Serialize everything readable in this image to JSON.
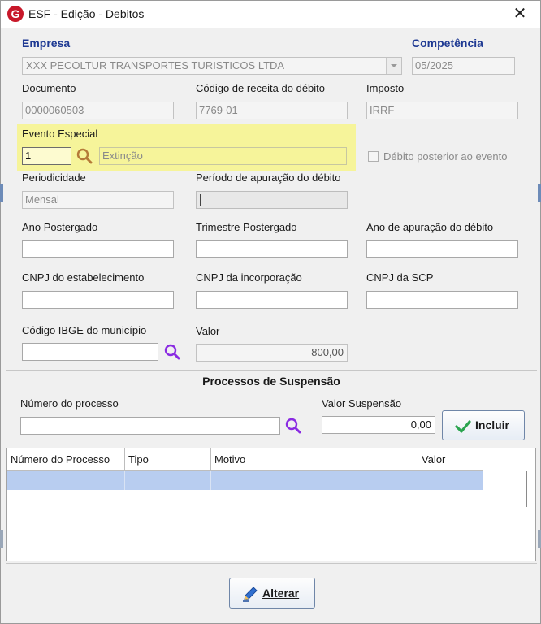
{
  "window": {
    "title": "ESF - Edição - Debitos",
    "close_label": "✕",
    "logo_letter": "G"
  },
  "fields": {
    "empresa": {
      "label": "Empresa",
      "value": "XXX PECOLTUR TRANSPORTES TURISTICOS LTDA"
    },
    "competencia": {
      "label": "Competência",
      "value": "05/2025"
    },
    "documento": {
      "label": "Documento",
      "value": "0000060503"
    },
    "codigo_receita": {
      "label": "Código de receita do débito",
      "value": "7769-01"
    },
    "imposto": {
      "label": "Imposto",
      "value": "IRRF"
    },
    "evento_especial": {
      "label": "Evento Especial",
      "code": "1",
      "description": "Extinção"
    },
    "debito_posterior": {
      "label": "Débito posterior ao evento",
      "checked": false
    },
    "periodicidade": {
      "label": "Periodicidade",
      "value": "Mensal"
    },
    "periodo_apuracao": {
      "label": "Período de apuração do débito",
      "value": ""
    },
    "ano_postergado": {
      "label": "Ano Postergado",
      "value": ""
    },
    "trimestre_postergado": {
      "label": "Trimestre Postergado",
      "value": ""
    },
    "ano_apuracao": {
      "label": "Ano de apuração do débito",
      "value": ""
    },
    "cnpj_estabelecimento": {
      "label": "CNPJ do estabelecimento",
      "value": ""
    },
    "cnpj_incorporacao": {
      "label": "CNPJ da incorporação",
      "value": ""
    },
    "cnpj_scp": {
      "label": "CNPJ da SCP",
      "value": ""
    },
    "codigo_ibge": {
      "label": "Código IBGE do município",
      "value": ""
    },
    "valor": {
      "label": "Valor",
      "value": "800,00"
    }
  },
  "suspensao": {
    "section_title": "Processos de Suspensão",
    "numero_processo": {
      "label": "Número do processo",
      "value": ""
    },
    "valor_suspensao": {
      "label": "Valor Suspensão",
      "value": "0,00"
    },
    "incluir_label": "Incluir",
    "table": {
      "columns": [
        "Número do Processo",
        "Tipo",
        "Motivo",
        "Valor"
      ],
      "rows": [
        [
          "",
          "",
          "",
          ""
        ]
      ]
    }
  },
  "actions": {
    "alterar_label": "Alterar"
  },
  "colors": {
    "accent_blue": "#1f3a93",
    "highlight": "#f6f49a",
    "selected_row": "#b8cdf0",
    "search_icon": "#8a2be2",
    "check_green": "#2aa44f"
  }
}
